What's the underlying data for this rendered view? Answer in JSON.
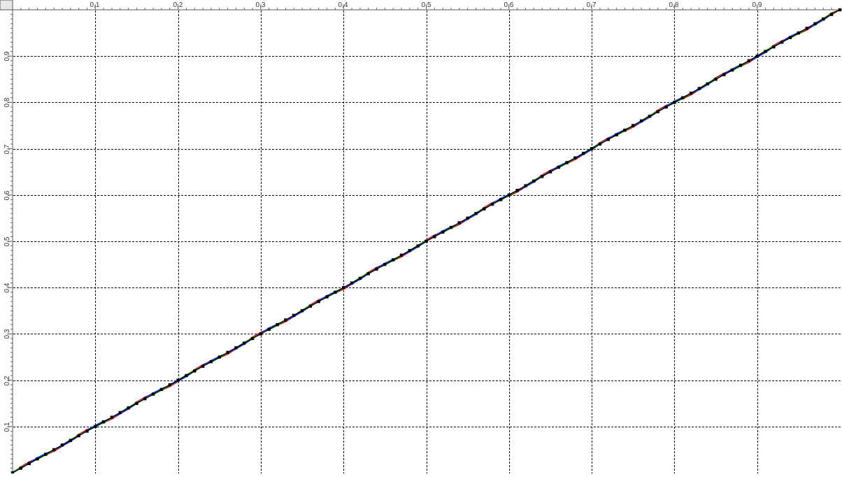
{
  "chart_data": {
    "type": "line",
    "title": "",
    "xlabel": "",
    "ylabel": "",
    "xlim": [
      0,
      1
    ],
    "ylim": [
      0,
      1
    ],
    "grid": true,
    "x_ticks": [
      0.1,
      0.2,
      0.3,
      0.4,
      0.5,
      0.6,
      0.7,
      0.8,
      0.9
    ],
    "y_ticks": [
      0.1,
      0.2,
      0.3,
      0.4,
      0.5,
      0.6,
      0.7,
      0.8,
      0.9
    ],
    "x_tick_labels": [
      "0,1",
      "0,2",
      "0,3",
      "0,4",
      "0,5",
      "0,6",
      "0,7",
      "0,8",
      "0,9"
    ],
    "y_tick_labels": [
      "0,1",
      "0,2",
      "0,3",
      "0,4",
      "0,5",
      "0,6",
      "0,7",
      "0,8",
      "0,9"
    ],
    "series": [
      {
        "color": "#e00000",
        "offset": 0.004
      },
      {
        "color": "#00b000",
        "offset": 0.002
      },
      {
        "color": "#0040ff",
        "offset": -0.003
      },
      {
        "color": "#000000",
        "offset": 0.0,
        "markers": true,
        "points": 100
      }
    ],
    "colors": {
      "grid": "#000000",
      "axis": "#555555",
      "ruler_bg": "#ffffff"
    }
  }
}
